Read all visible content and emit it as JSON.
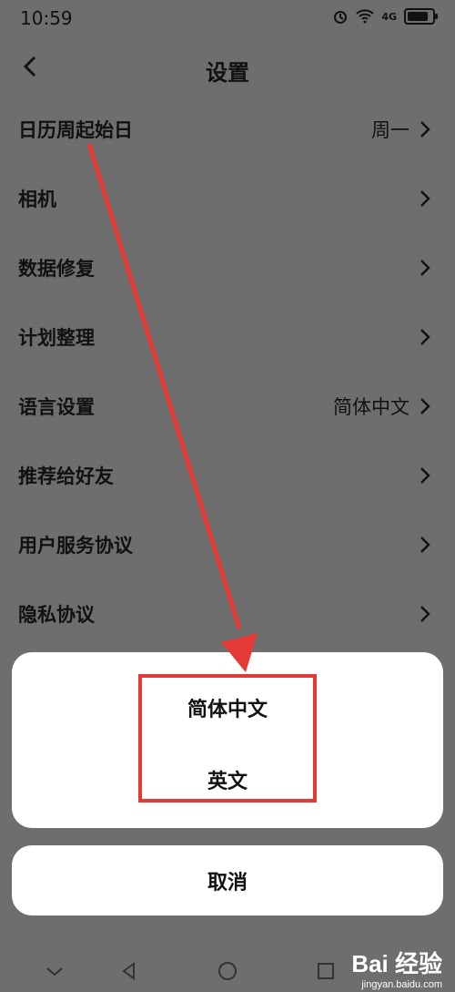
{
  "status_bar": {
    "time": "10:59",
    "signal": "4G"
  },
  "header": {
    "title": "设置"
  },
  "settings": {
    "items": [
      {
        "label": "日历周起始日",
        "value": "周一"
      },
      {
        "label": "相机",
        "value": ""
      },
      {
        "label": "数据修复",
        "value": ""
      },
      {
        "label": "计划整理",
        "value": ""
      },
      {
        "label": "语言设置",
        "value": "简体中文"
      },
      {
        "label": "推荐给好友",
        "value": ""
      },
      {
        "label": "用户服务协议",
        "value": ""
      },
      {
        "label": "隐私协议",
        "value": ""
      }
    ]
  },
  "language_sheet": {
    "options": [
      "简体中文",
      "英文"
    ],
    "cancel": "取消"
  },
  "watermark": {
    "main": "Bai 经验",
    "sub": "jingyan.baidu.com"
  },
  "colors": {
    "dim_background": "#6e6e6e",
    "annotation_red": "#e53935",
    "sheet_bg": "#ffffff"
  }
}
